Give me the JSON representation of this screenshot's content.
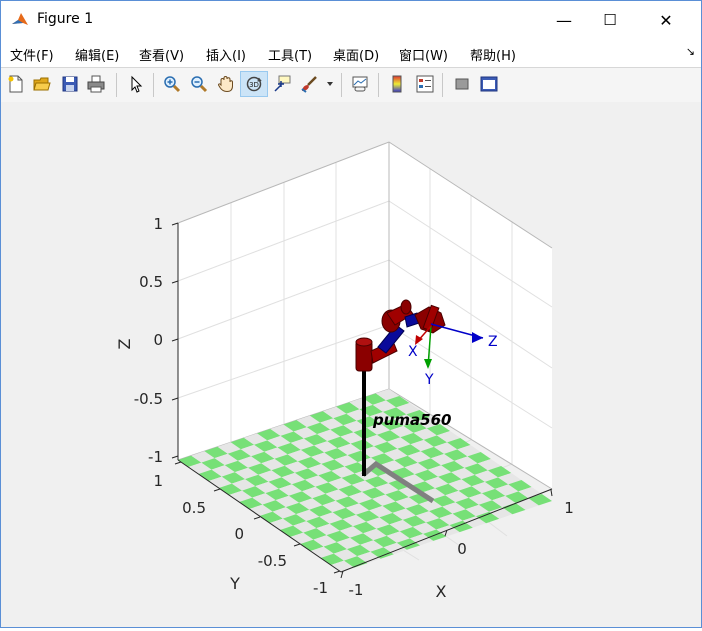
{
  "window": {
    "title": "Figure 1",
    "controls": {
      "minimize": "—",
      "maximize": "☐",
      "close": "✕"
    }
  },
  "menu": [
    "文件(F)",
    "编辑(E)",
    "查看(V)",
    "插入(I)",
    "工具(T)",
    "桌面(D)",
    "窗口(W)",
    "帮助(H)"
  ],
  "toolbar": {
    "buttons": [
      "new-figure",
      "open-file",
      "save-figure",
      "print-figure",
      "edit-plot",
      "zoom-in",
      "zoom-out",
      "pan",
      "rotate-3d",
      "data-cursor",
      "brush",
      "link-plot",
      "insert-colorbar",
      "insert-legend",
      "hide-plot-tools",
      "show-plot-tools"
    ],
    "active": "rotate-3d"
  },
  "axes": {
    "z_label": "Z",
    "y_label": "Y",
    "x_label": "X",
    "z_ticks": [
      "1",
      "0.5",
      "0",
      "-0.5",
      "-1"
    ],
    "y_ticks": [
      "1",
      "0.5",
      "0",
      "-0.5",
      "-1"
    ],
    "x_ticks": [
      "-1",
      "0",
      "1"
    ],
    "grid": true
  },
  "robot": {
    "name": "puma560",
    "frame_labels": {
      "x": "X",
      "y": "Y",
      "z": "Z"
    },
    "colors": {
      "links": "#8b0000",
      "joints": "#0a0a9a",
      "floor_a": "#77e077",
      "floor_b": "#e6e6e6",
      "shadow": "#808080",
      "x_axis": "#c00000",
      "y_axis": "#00a000",
      "z_axis": "#0000c8"
    }
  }
}
